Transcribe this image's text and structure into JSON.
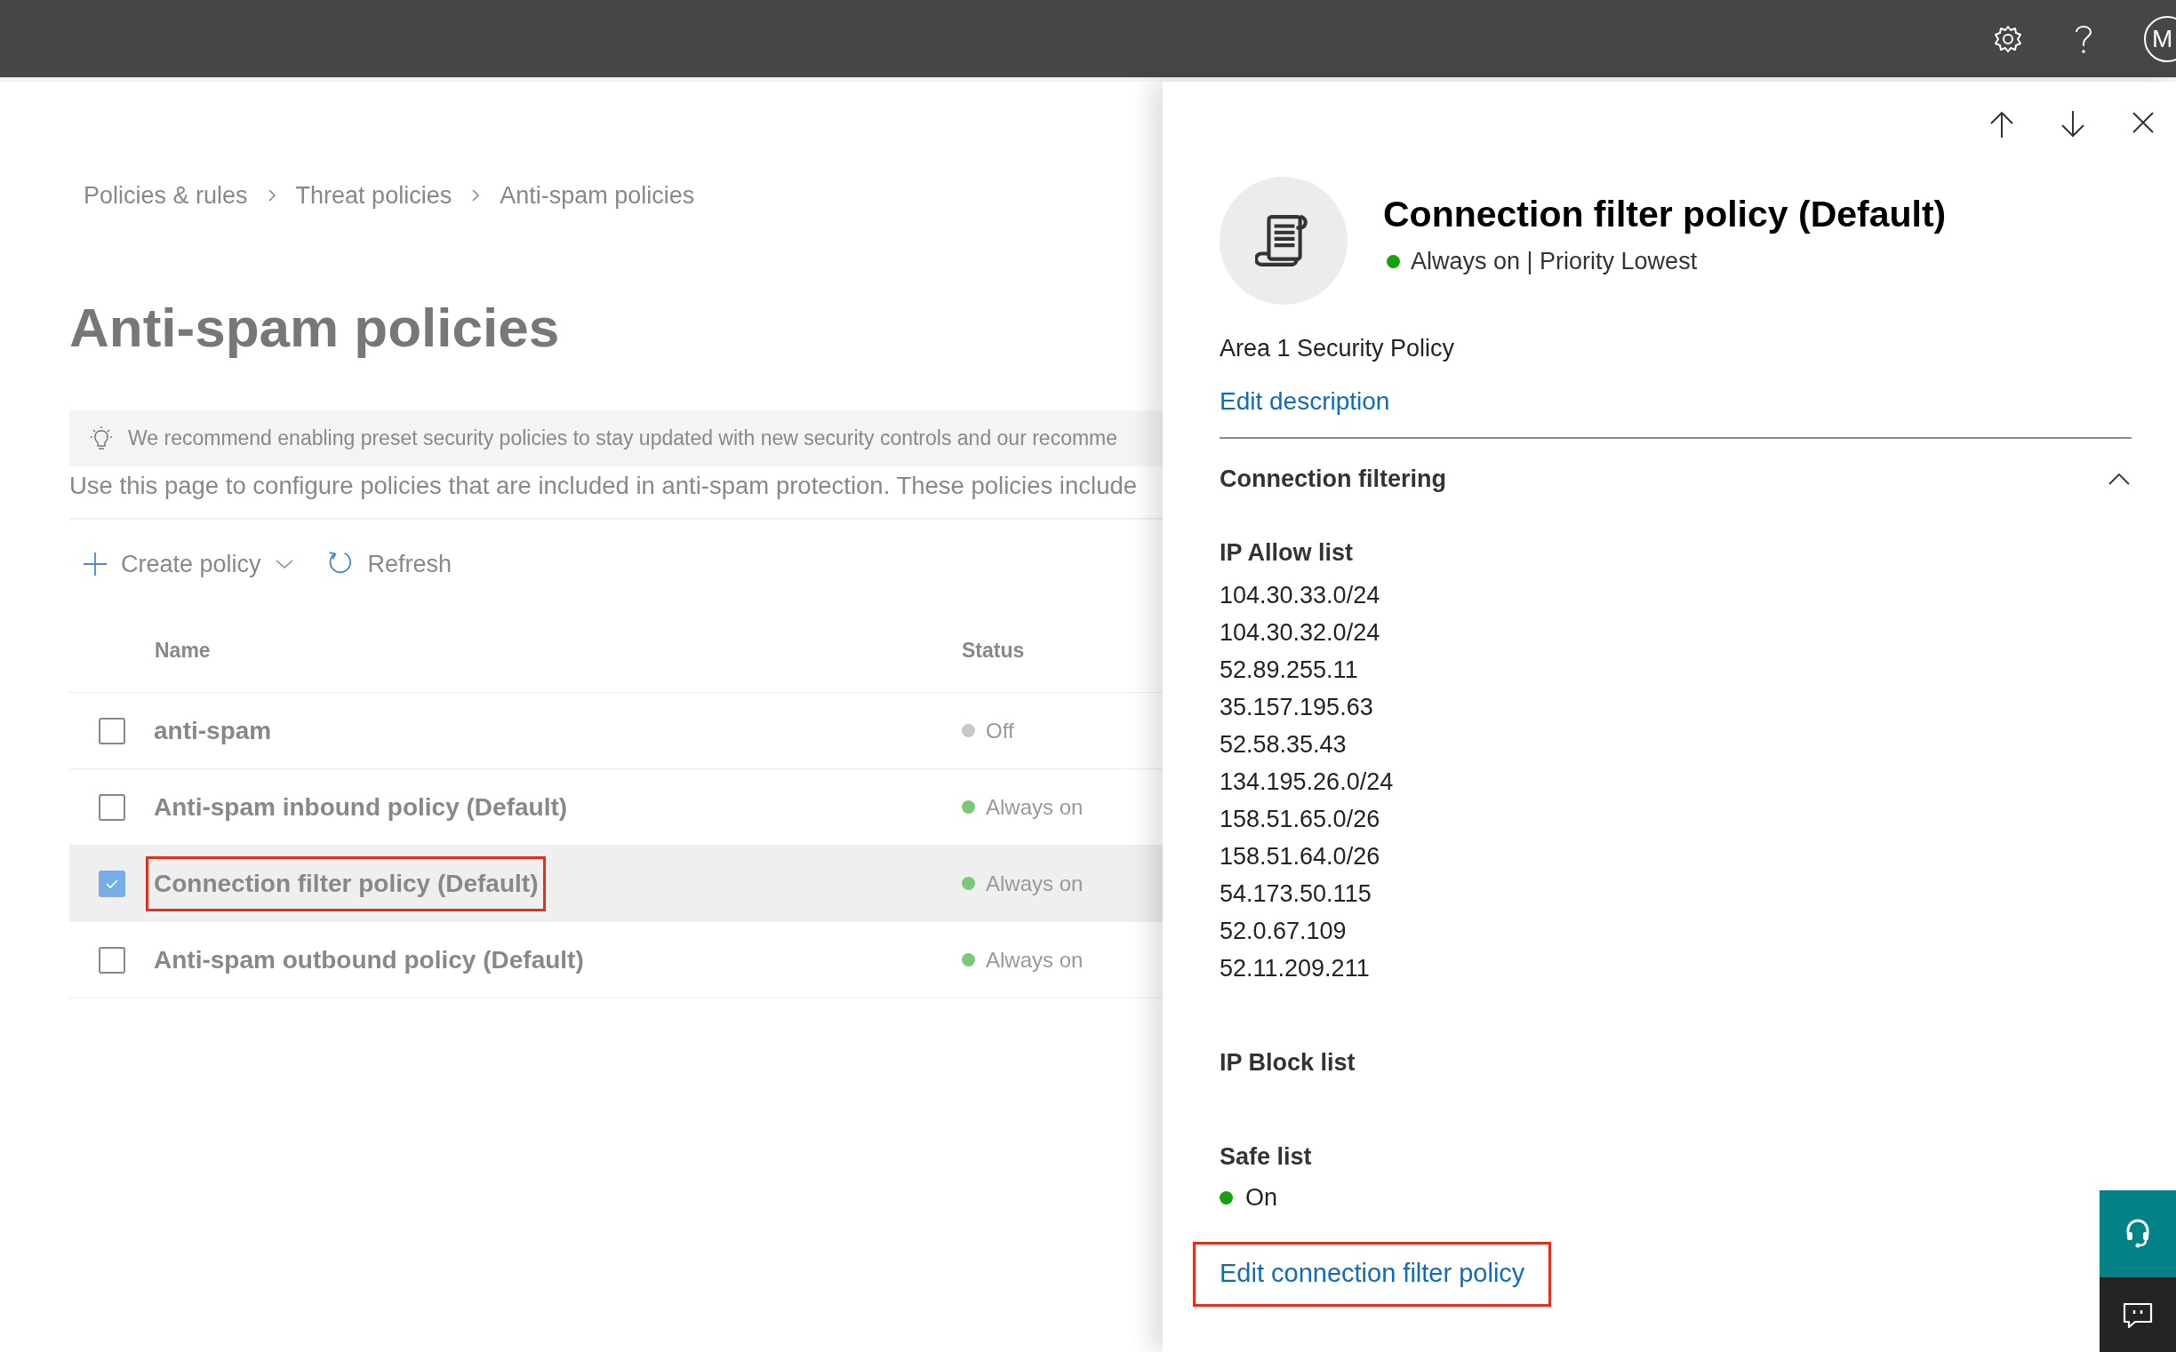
{
  "top_bar": {
    "avatar_initial": "M"
  },
  "breadcrumb": [
    "Policies & rules",
    "Threat policies",
    "Anti-spam policies"
  ],
  "page_title": "Anti-spam policies",
  "recommendation": "We recommend enabling preset security policies to stay updated with new security controls and our recomme",
  "description": "Use this page to configure policies that are included in anti-spam protection. These policies include",
  "toolbar": [
    {
      "label": "Create policy",
      "kind": "create"
    },
    {
      "label": "Refresh",
      "kind": "refresh"
    }
  ],
  "table": {
    "columns": [
      "Name",
      "Status"
    ],
    "rows": [
      {
        "name": "anti-spam",
        "status": "Off",
        "on": false,
        "selected": false,
        "highlighted": false
      },
      {
        "name": "Anti-spam inbound policy (Default)",
        "status": "Always on",
        "on": true,
        "selected": false,
        "highlighted": false
      },
      {
        "name": "Connection filter policy (Default)",
        "status": "Always on",
        "on": true,
        "selected": true,
        "highlighted": true
      },
      {
        "name": "Anti-spam outbound policy (Default)",
        "status": "Always on",
        "on": true,
        "selected": false,
        "highlighted": false
      }
    ]
  },
  "panel": {
    "title": "Connection filter policy (Default)",
    "status": "Always on | Priority Lowest",
    "on": true,
    "description": "Area 1 Security Policy",
    "edit_link": "Edit description",
    "section": {
      "title": "Connection filtering",
      "expanded": true,
      "groups": [
        {
          "heading": "IP Allow list",
          "items": [
            "104.30.33.0/24",
            "104.30.32.0/24",
            "52.89.255.11",
            "35.157.195.63",
            "52.58.35.43",
            "134.195.26.0/24",
            "158.51.65.0/26",
            "158.51.64.0/26",
            "54.173.50.115",
            "52.0.67.109",
            "52.11.209.211"
          ]
        },
        {
          "heading": "IP Block list"
        },
        {
          "heading": "Safe list",
          "status": {
            "label": "On",
            "on": true
          }
        }
      ]
    },
    "action_link": {
      "label": "Edit connection filter policy",
      "highlighted": true
    }
  }
}
